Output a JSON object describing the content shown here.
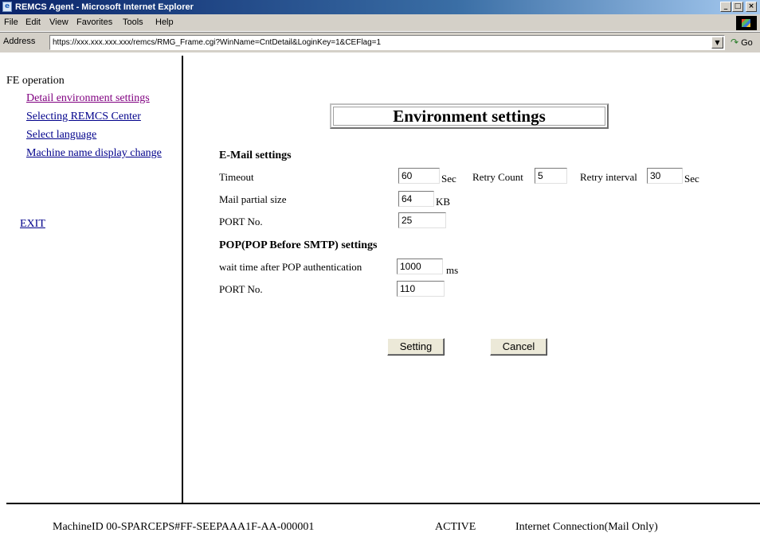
{
  "window": {
    "title": "REMCS Agent - Microsoft Internet Explorer",
    "icon": "ie-icon",
    "controls": [
      "_",
      "□",
      "×"
    ]
  },
  "menubar": {
    "items": [
      "File",
      "Edit",
      "View",
      "Favorites",
      "Tools",
      "Help"
    ]
  },
  "addressbar": {
    "label": "Address",
    "url": "https://xxx.xxx.xxx.xxx/remcs/RMG_Frame.cgi?WinName=CntDetail&LoginKey=1&CEFlag=1",
    "dropdown_glyph": "▼",
    "go_label": "Go",
    "go_glyph": "↷"
  },
  "sidebar": {
    "heading": "FE operation",
    "links": [
      {
        "label": "Detail environment settings",
        "visited": true
      },
      {
        "label": "Selecting REMCS Center",
        "visited": false
      },
      {
        "label": "Select language",
        "visited": false
      },
      {
        "label": "Machine name display change",
        "visited": false
      }
    ],
    "exit_label": "EXIT"
  },
  "main": {
    "title": "Environment settings",
    "email": {
      "heading": "E-Mail settings",
      "timeout_label": "Timeout",
      "timeout_value": "60",
      "timeout_unit": "Sec",
      "retry_count_label": "Retry Count",
      "retry_count_value": "5",
      "retry_interval_label": "Retry interval",
      "retry_interval_value": "30",
      "retry_interval_unit": "Sec",
      "partial_size_label": "Mail partial size",
      "partial_size_value": "64",
      "partial_size_unit": "KB",
      "port_label": "PORT No.",
      "port_value": "25"
    },
    "pop": {
      "heading": "POP(POP Before SMTP) settings",
      "wait_label": "wait time after POP authentication",
      "wait_value": "1000",
      "wait_unit": "ms",
      "port_label": "PORT No.",
      "port_value": "110"
    },
    "buttons": {
      "setting": "Setting",
      "cancel": "Cancel"
    }
  },
  "footer": {
    "machine_id": "MachineID  00-SPARCEPS#FF-SEEPAAA1F-AA-000001",
    "status": "ACTIVE",
    "connection": "Internet Connection(Mail Only)"
  },
  "colors": {
    "titlebar_start": "#0a246a",
    "chrome": "#d4d0c8",
    "link": "#00008b",
    "visited_link": "#800080"
  }
}
